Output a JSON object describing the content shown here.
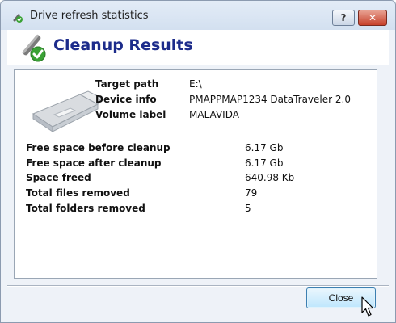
{
  "window": {
    "title": "Drive refresh statistics"
  },
  "titlebar_buttons": {
    "help": "?",
    "close": "✕"
  },
  "header": {
    "title": "Cleanup Results"
  },
  "info": [
    {
      "label": "Target path",
      "value": "E:\\"
    },
    {
      "label": "Device info",
      "value": "PMAPPMAP1234 DataTraveler 2.0"
    },
    {
      "label": "Volume label",
      "value": "MALAVIDA"
    }
  ],
  "stats": [
    {
      "label": "Free space before cleanup",
      "value": "6.17 Gb"
    },
    {
      "label": "Free space after cleanup",
      "value": "6.17 Gb"
    },
    {
      "label": "Space freed",
      "value": "640.98 Kb"
    },
    {
      "label": "Total files removed",
      "value": "79"
    },
    {
      "label": "Total folders removed",
      "value": "5"
    }
  ],
  "buttons": {
    "close": "Close"
  },
  "colors": {
    "header_title": "#1d2c8b",
    "check_green": "#3aa235",
    "button_border": "#3c7fb1"
  },
  "icons": {
    "title": "pen-check-icon",
    "header": "pen-check-icon",
    "drive": "usb-drive-icon",
    "cursor": "mouse-pointer-icon"
  }
}
